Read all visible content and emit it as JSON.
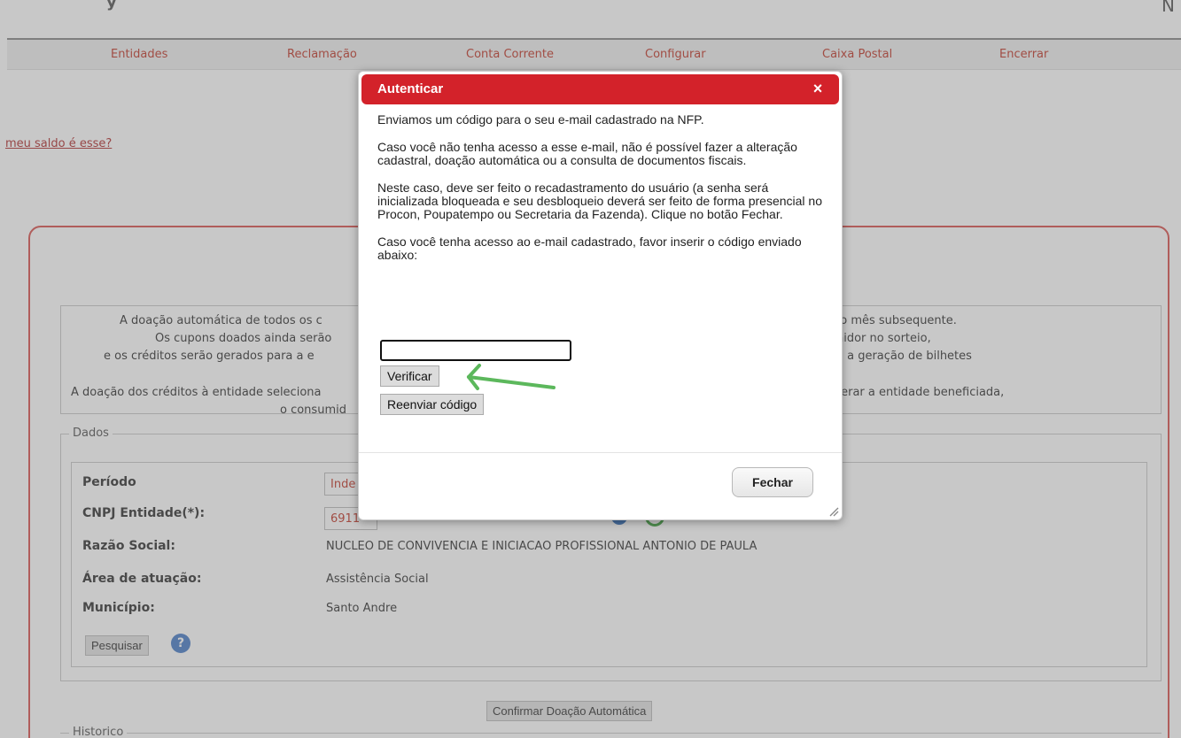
{
  "nav": {
    "items": [
      {
        "label": "Entidades"
      },
      {
        "label": "Reclamação"
      },
      {
        "label": "Conta Corrente"
      },
      {
        "label": "Configurar"
      },
      {
        "label": "Caixa Postal"
      },
      {
        "label": "Encerrar"
      }
    ]
  },
  "header": {
    "left_glyph": "y",
    "right_glyph": "N"
  },
  "saldo_link": "meu saldo é esse?",
  "info": {
    "line1_left": "A doação automática de todos os c",
    "line1_right": "do mês subsequente.",
    "line2_left": "Os cupons doados ainda serão",
    "line2_right": "nidor no sorteio,",
    "line3_left": "e os créditos serão gerados para a e",
    "line3_right": "a a geração de bilhetes",
    "line4_left": "A doação dos créditos à entidade seleciona",
    "line4_right": "terar a entidade beneficiada,",
    "line5_left": "o consumid"
  },
  "dados": {
    "legend": "Dados",
    "periodo_label": "Período",
    "periodo_value": "Inde",
    "cnpj_label": "CNPJ Entidade(*):",
    "cnpj_value": "6911",
    "razao_label": "Razão Social:",
    "razao_value": "NUCLEO DE CONVIVENCIA E INICIACAO PROFISSIONAL ANTONIO DE PAULA",
    "area_label": "Área de atuação:",
    "area_value": "Assistência Social",
    "municipio_label": "Município:",
    "municipio_value": "Santo Andre",
    "pesquisar": "Pesquisar",
    "help": "?"
  },
  "confirmar": "Confirmar Doação Automática",
  "historico_legend": "Historico",
  "dialog": {
    "title": "Autenticar",
    "close": "×",
    "p1": "Enviamos um código para o seu e-mail cadastrado na NFP.",
    "p2": "Caso você não tenha acesso a esse e-mail, não é possível fazer a alteração cadastral, doação automática ou a consulta de documentos fiscais.",
    "p3": "Neste caso, deve ser feito o recadastramento do usuário (a senha será inicializada bloqueada e seu desbloqueio deverá ser feito de forma presencial no Procon, Poupatempo ou Secretaria da Fazenda). Clique no botão Fechar.",
    "p4": "Caso você tenha acesso ao e-mail cadastrado, favor inserir o código enviado abaixo:",
    "code_value": "",
    "verificar": "Verificar",
    "reenviar": "Reenviar código",
    "fechar": "Fechar"
  },
  "colors": {
    "accent_red": "#d3222a",
    "nav_text": "#c0392b",
    "arrow": "#5cb85c"
  }
}
